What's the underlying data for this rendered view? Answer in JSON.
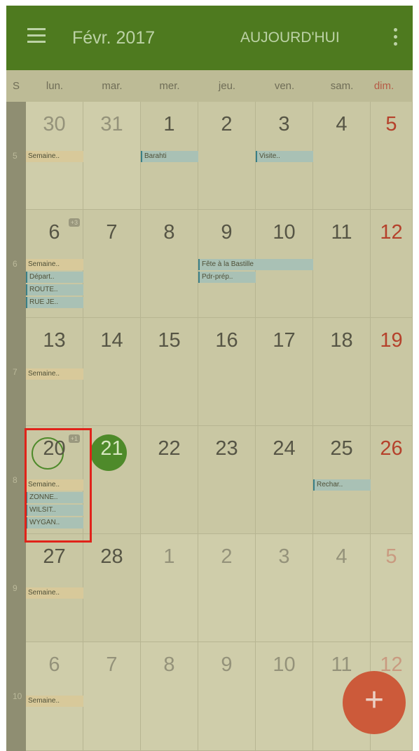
{
  "header": {
    "title": "Févr. 2017",
    "today_label": "AUJOURD'HUI",
    "menu_icon": "hamburger-icon",
    "more_icon": "overflow-menu-icon"
  },
  "weekdays": [
    "S",
    "lun.",
    "mar.",
    "mer.",
    "jeu.",
    "ven.",
    "sam.",
    "dim."
  ],
  "weeks": [
    {
      "number": "5",
      "days": [
        "30",
        "31",
        "1",
        "2",
        "3",
        "4",
        "5"
      ]
    },
    {
      "number": "6",
      "days": [
        "6",
        "7",
        "8",
        "9",
        "10",
        "11",
        "12"
      ],
      "badge": "+3"
    },
    {
      "number": "7",
      "days": [
        "13",
        "14",
        "15",
        "16",
        "17",
        "18",
        "19"
      ]
    },
    {
      "number": "8",
      "days": [
        "20",
        "21",
        "22",
        "23",
        "24",
        "25",
        "26"
      ],
      "badge": "+1"
    },
    {
      "number": "9",
      "days": [
        "27",
        "28",
        "1",
        "2",
        "3",
        "4",
        "5"
      ]
    },
    {
      "number": "10",
      "days": [
        "6",
        "7",
        "8",
        "9",
        "10",
        "11",
        "12"
      ]
    }
  ],
  "events": {
    "w5": [
      "Semaine..",
      "Barahti",
      "Visite.."
    ],
    "w6": [
      "Semaine..",
      "Départ..",
      "ROUTE..",
      "RUE JE..",
      "Fête à la Bastille",
      "Pdr-prép.."
    ],
    "w7": [
      "Semaine.."
    ],
    "w8": [
      "Semaine..",
      "ZONNE..",
      "WILSIT..",
      "WYGAN..",
      "Rechar.."
    ],
    "w9": [
      "Semaine.."
    ],
    "w10": [
      "Semaine.."
    ]
  },
  "fab_label": "+",
  "colors": {
    "toolbar": "#4e7a1f",
    "today": "#4e8a2a",
    "sunday": "#b5412b",
    "fab": "#cc5a3a",
    "highlight": "#e0231a"
  }
}
